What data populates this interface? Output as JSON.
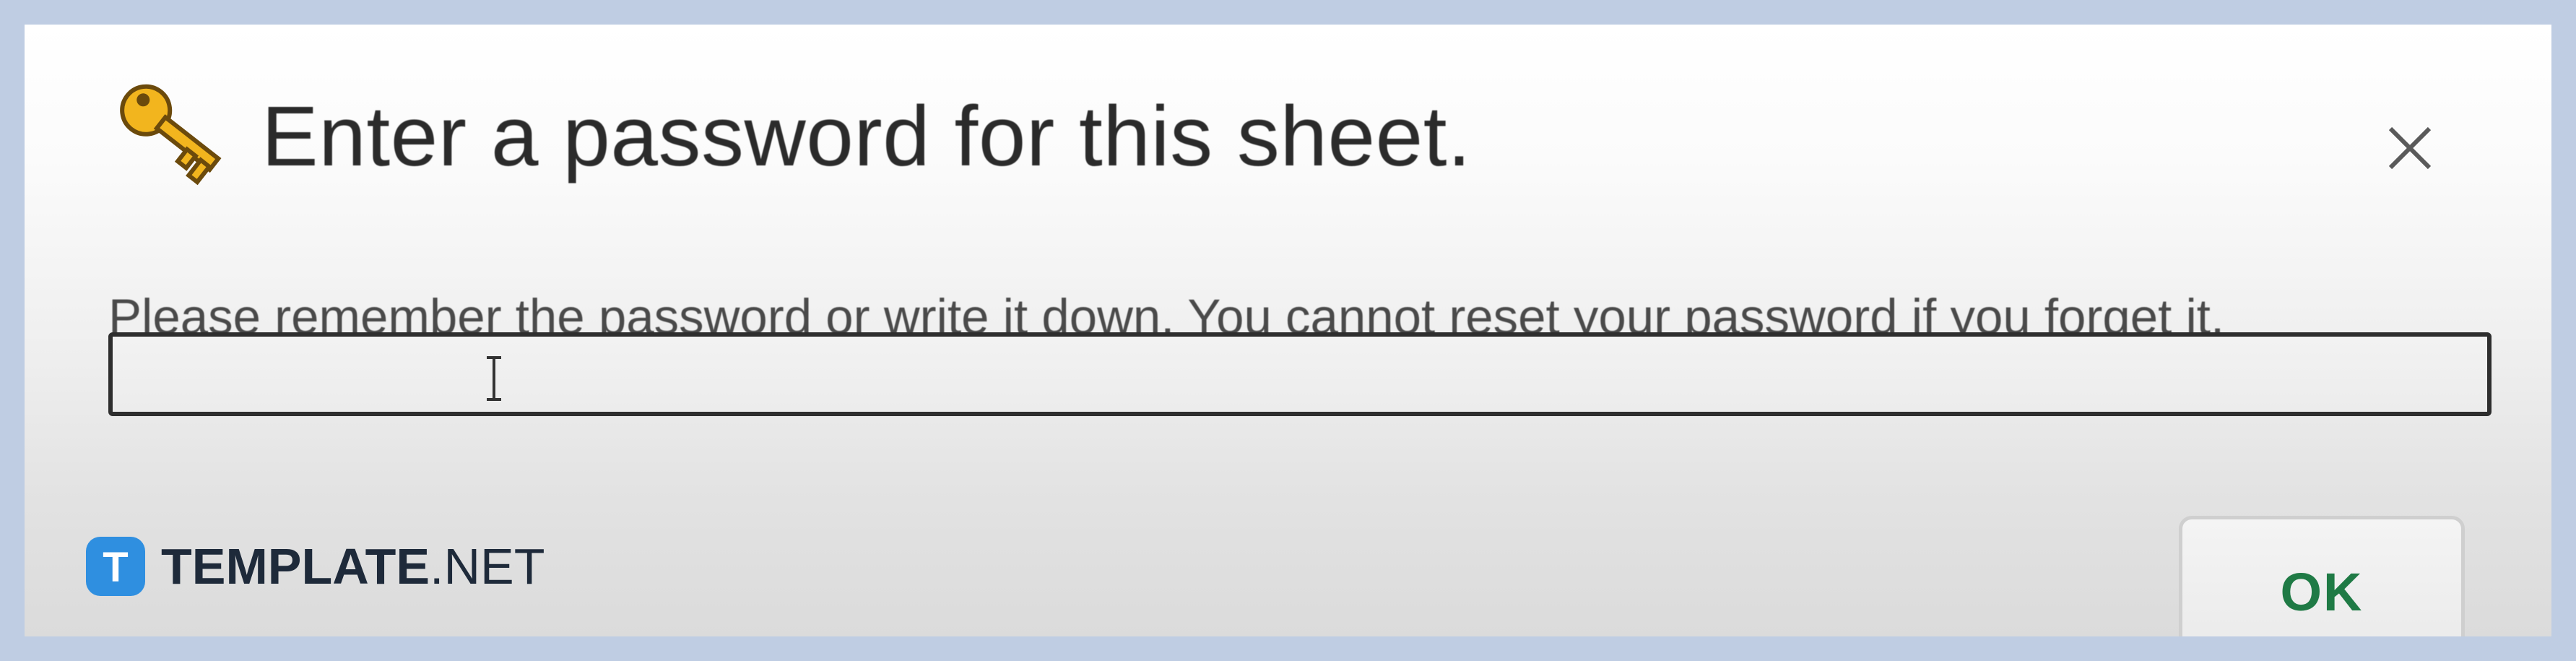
{
  "dialog": {
    "title": "Enter a password for this sheet.",
    "hint": "Please remember the password or write it down. You cannot reset your password if you forget it.",
    "password_value": "",
    "ok_label": "OK",
    "close_icon": "close-icon",
    "title_icon": "key-icon"
  },
  "branding": {
    "logo_letter": "T",
    "name_bold": "TEMPLATE",
    "name_suffix": ".NET"
  },
  "colors": {
    "frame": "#bfcde3",
    "ok_text": "#1f7a45",
    "key_gold": "#f2b51e",
    "brand_blue": "#2f8fe0"
  }
}
